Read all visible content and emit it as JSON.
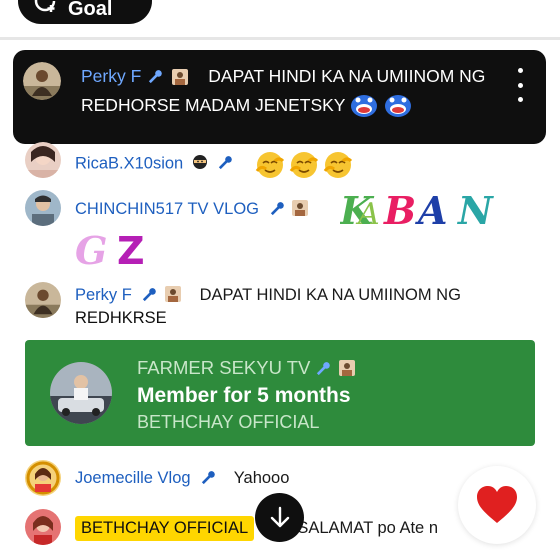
{
  "goal": {
    "label": "Goal"
  },
  "pinned": {
    "author": "Perky F",
    "text_line1": "DAPAT HINDI KA NA UMIINOM NG",
    "text_line2": "REDHORSE MADAM JENETSKY",
    "emojis": [
      "laughing-blob-emoji",
      "laughing-blob-emoji"
    ]
  },
  "messages": [
    {
      "author": "RicaB.X10sion",
      "badges": [
        "ninja-emoji",
        "wrench-icon"
      ],
      "emoji_message": [
        "hug-emoji",
        "hug-emoji",
        "hug-emoji"
      ]
    },
    {
      "author": "CHINCHIN517 TV VLOG",
      "badges": [
        "wrench-icon",
        "member-badge"
      ],
      "art_text": "KABANGZ"
    },
    {
      "author": "Perky F",
      "badges": [
        "wrench-icon",
        "member-badge"
      ],
      "text": "DAPAT HINDI KA NA UMIINOM NG",
      "text_cont": "REDHKRSE"
    },
    {
      "author": "Joemecille Vlog",
      "badges": [
        "wrench-icon"
      ],
      "text": "Yahooo"
    },
    {
      "author": "BETHCHAY OFFICIAL",
      "owner": true,
      "text": "SALAMAT po Ate n"
    }
  ],
  "membership": {
    "name": "FARMER SEKYU TV",
    "duration": "Member for 5 months",
    "channel": "BETHCHAY OFFICIAL"
  },
  "colors": {
    "author_blue": "#1e5fbf",
    "member_green": "#2e8b3c",
    "owner_yellow": "#ffd600",
    "heart_red": "#e02020"
  }
}
